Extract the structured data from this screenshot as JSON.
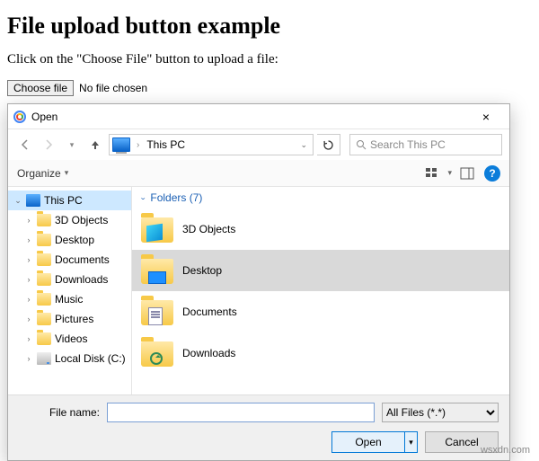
{
  "page": {
    "heading": "File upload button example",
    "instruction": "Click on the \"Choose File\" button to upload a file:",
    "choose_label": "Choose file",
    "no_file": "No file chosen"
  },
  "dialog": {
    "title": "Open",
    "close": "×",
    "nav": {
      "crumb": "This PC",
      "search_placeholder": "Search This PC"
    },
    "toolbar": {
      "organize": "Organize",
      "help": "?"
    },
    "tree": {
      "root": "This PC",
      "items": [
        {
          "label": "3D Objects",
          "icon": "folder"
        },
        {
          "label": "Desktop",
          "icon": "folder"
        },
        {
          "label": "Documents",
          "icon": "folder"
        },
        {
          "label": "Downloads",
          "icon": "folder"
        },
        {
          "label": "Music",
          "icon": "folder"
        },
        {
          "label": "Pictures",
          "icon": "folder"
        },
        {
          "label": "Videos",
          "icon": "folder"
        },
        {
          "label": "Local Disk (C:)",
          "icon": "drive"
        }
      ]
    },
    "group": {
      "title": "Folders (7)"
    },
    "items": [
      {
        "label": "3D Objects",
        "overlay": "cube",
        "selected": false
      },
      {
        "label": "Desktop",
        "overlay": "screen",
        "selected": true
      },
      {
        "label": "Documents",
        "overlay": "doc",
        "selected": false
      },
      {
        "label": "Downloads",
        "overlay": "arrow",
        "selected": false
      }
    ],
    "footer": {
      "filename_label": "File name:",
      "filename_value": "",
      "filter": "All Files (*.*)",
      "open": "Open",
      "cancel": "Cancel"
    }
  },
  "watermark": "wsxdn.com"
}
